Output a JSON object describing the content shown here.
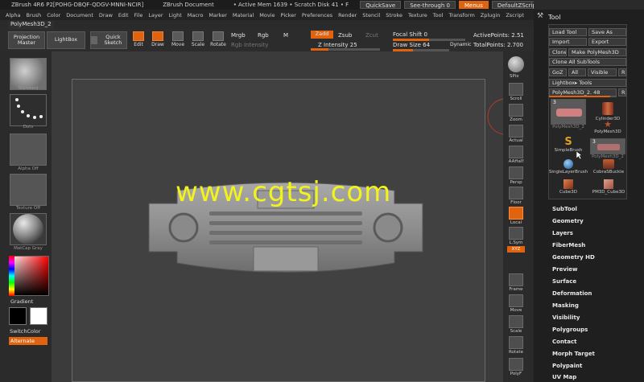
{
  "titlebar": {
    "title": "ZBrush 4R6 P2[POHG-DBQF-QDGV-MNNI-NCIR]",
    "doc": "ZBrush Document",
    "mem": "• Active Mem 1639 • Scratch Disk 41 • F",
    "quicksave": "QuickSave",
    "seethrough": "See-through",
    "seethrough_value": "0",
    "menus": "Menus",
    "script": "DefaultZScript"
  },
  "menubar": [
    "Alpha",
    "Brush",
    "Color",
    "Document",
    "Draw",
    "Edit",
    "File",
    "Layer",
    "Light",
    "Macro",
    "Marker",
    "Material",
    "Movie",
    "Picker",
    "Preferences",
    "Render",
    "Stencil",
    "Stroke",
    "Texture",
    "Tool",
    "Transform",
    "Zplugin",
    "Zscript"
  ],
  "subtitle": "PolyMesh3D_2",
  "shelf": {
    "projection_master": "Projection Master",
    "lightbox": "LightBox",
    "quick_sketch": "Quick Sketch",
    "edit": "Edit",
    "draw": "Draw",
    "move": "Move",
    "scale": "Scale",
    "rotate": "Rotate",
    "mrgb": "Mrgb",
    "rgb": "Rgb",
    "m": "M",
    "rgb_intensity": "Rgb Intensity",
    "zadd": "Zadd",
    "zsub": "Zsub",
    "zcut": "Zcut",
    "z_intensity_label": "Z Intensity",
    "z_intensity_value": "25",
    "focal_shift_label": "Focal Shift",
    "focal_shift_value": "0",
    "draw_size_label": "Draw Size",
    "draw_size_value": "64",
    "dynamic": "Dynamic",
    "active_points_label": "ActivePoints:",
    "active_points_value": "2.51",
    "total_points_label": "TotalPoints:",
    "total_points_value": "2.700"
  },
  "left": {
    "brush": "Standard",
    "stroke": "Dots",
    "alpha": "Alpha Off",
    "texture": "Texture Off",
    "material": "MatCap Gray",
    "gradient": "Gradient",
    "switchcolor": "SwitchColor",
    "alternate": "Alternate"
  },
  "right": [
    "SPix",
    "Scroll",
    "Zoom",
    "Actual",
    "AAHalf",
    "Persp",
    "Floor",
    "Local",
    "L.Sym",
    "XYZ",
    "Frame",
    "Move",
    "Scale",
    "Rotate",
    "PolyF"
  ],
  "watermark": "www.cgtsj.com",
  "tool": {
    "title": "Tool",
    "load_tool": "Load Tool",
    "save_as": "Save As",
    "import": "Import",
    "export": "Export",
    "clone": "Clone",
    "make_polymesh": "Make PolyMesh3D",
    "clone_all": "Clone All SubTools",
    "goz": "GoZ",
    "all": "All",
    "visible": "Visible",
    "r": "R",
    "lightbox_tools": "Lightbox▸ Tools",
    "current_tool": "PolyMesh3D_2. 48",
    "thumbs": [
      "PolyMesh3D_2",
      "Cylinder3D",
      "PolyMesh3D",
      "SimpleBrush",
      "PolyMesh3D_2",
      "SingleLayerBrush",
      "CobraSBuckle",
      "Cube3D",
      "PM3D_Cube3D"
    ],
    "thumb_count_1": "3",
    "thumb_count_2": "3",
    "submenus": [
      "SubTool",
      "Geometry",
      "Layers",
      "FiberMesh",
      "Geometry HD",
      "Preview",
      "Surface",
      "Deformation",
      "Masking",
      "Visibility",
      "Polygroups",
      "Contact",
      "Morph Target",
      "Polypaint",
      "UV Map"
    ]
  }
}
